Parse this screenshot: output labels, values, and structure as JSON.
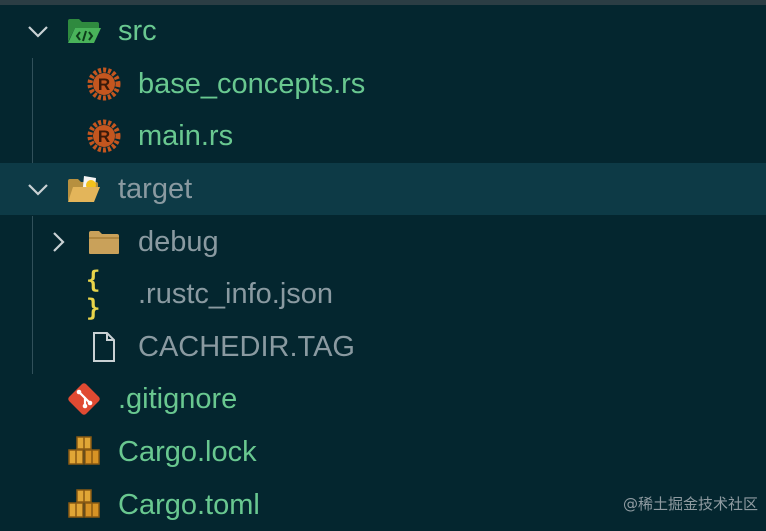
{
  "explorer": {
    "items": [
      {
        "label": "src",
        "icon": "folder-src-open-icon",
        "expanded": true
      },
      {
        "label": "base_concepts.rs",
        "icon": "rust-file-icon"
      },
      {
        "label": "main.rs",
        "icon": "rust-file-icon"
      },
      {
        "label": "target",
        "icon": "folder-target-open-icon",
        "expanded": true,
        "selected": true
      },
      {
        "label": "debug",
        "icon": "folder-icon",
        "expanded": false
      },
      {
        "label": ".rustc_info.json",
        "icon": "json-file-icon",
        "glyph": "{ }"
      },
      {
        "label": "CACHEDIR.TAG",
        "icon": "generic-file-icon"
      },
      {
        "label": ".gitignore",
        "icon": "git-icon"
      },
      {
        "label": "Cargo.lock",
        "icon": "cargo-package-icon"
      },
      {
        "label": "Cargo.toml",
        "icon": "cargo-package-icon"
      }
    ]
  },
  "colors": {
    "background": "#04262f",
    "selected_row": "#0d3a46",
    "label_green": "#69c890",
    "label_gray": "#8a9aa1",
    "rust_orange": "#c4561f",
    "git_red": "#e04a32",
    "json_yellow": "#e9d44a"
  },
  "watermark": "@稀土掘金技术社区"
}
